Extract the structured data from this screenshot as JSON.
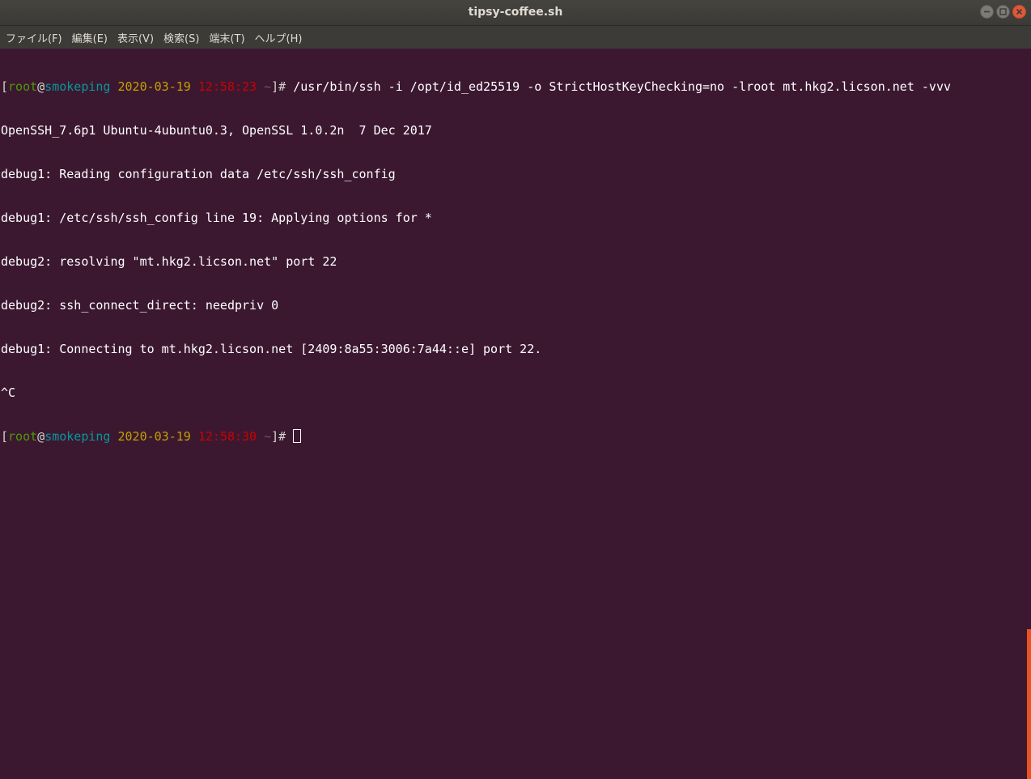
{
  "window": {
    "title": "tipsy-coffee.sh"
  },
  "titlebar_buttons": [
    {
      "name": "minimize",
      "icon": "minimize-icon"
    },
    {
      "name": "maximize",
      "icon": "maximize-icon"
    },
    {
      "name": "close",
      "icon": "close-icon"
    }
  ],
  "menu": {
    "items": [
      "ファイル(F)",
      "編集(E)",
      "表示(V)",
      "検索(S)",
      "端末(T)",
      "ヘルプ(H)"
    ]
  },
  "colors": {
    "terminal_bg": "#3b1830",
    "prompt_user": "#4e9a06",
    "prompt_host": "#06989a",
    "prompt_date": "#c4a000",
    "prompt_time": "#cc0000",
    "prompt_dir": "#75507b",
    "scrollbar": "#e95420"
  },
  "terminal": {
    "prompt1": {
      "open": "[",
      "user": "root",
      "at": "@",
      "host": "smokeping",
      "date": "2020-03-19",
      "time": "12:58:23",
      "dir": "~",
      "close": "]#",
      "command": " /usr/bin/ssh -i /opt/id_ed25519 -o StrictHostKeyChecking=no -lroot mt.hkg2.licson.net -vvv"
    },
    "output": [
      "OpenSSH_7.6p1 Ubuntu-4ubuntu0.3, OpenSSL 1.0.2n  7 Dec 2017",
      "debug1: Reading configuration data /etc/ssh/ssh_config",
      "debug1: /etc/ssh/ssh_config line 19: Applying options for *",
      "debug2: resolving \"mt.hkg2.licson.net\" port 22",
      "debug2: ssh_connect_direct: needpriv 0",
      "debug1: Connecting to mt.hkg2.licson.net [2409:8a55:3006:7a44::e] port 22.",
      "^C"
    ],
    "prompt2": {
      "open": "[",
      "user": "root",
      "at": "@",
      "host": "smokeping",
      "date": "2020-03-19",
      "time": "12:58:30",
      "dir": "~",
      "close": "]#",
      "command": " "
    }
  }
}
